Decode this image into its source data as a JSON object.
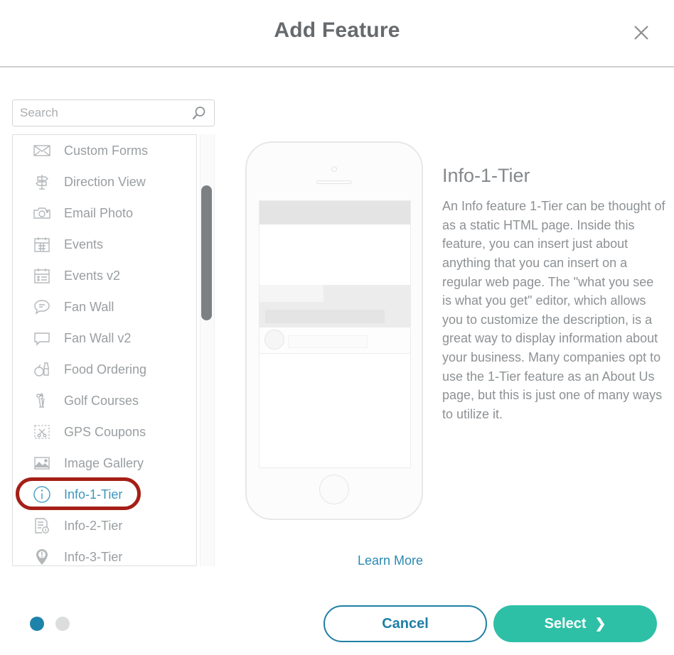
{
  "header": {
    "title": "Add Feature",
    "close_icon": "close-icon"
  },
  "search": {
    "placeholder": "Search",
    "value": "",
    "icon": "search-icon"
  },
  "feature_list": {
    "selected": "Info-1-Tier",
    "items": [
      {
        "label": "Custom Forms",
        "icon": "envelope-icon",
        "selected": false
      },
      {
        "label": "Direction View",
        "icon": "signpost-icon",
        "selected": false
      },
      {
        "label": "Email Photo",
        "icon": "camera-icon",
        "selected": false
      },
      {
        "label": "Events",
        "icon": "calendar-grid-icon",
        "selected": false
      },
      {
        "label": "Events v2",
        "icon": "calendar-list-icon",
        "selected": false
      },
      {
        "label": "Fan Wall",
        "icon": "speech-bubble-icon",
        "selected": false
      },
      {
        "label": "Fan Wall v2",
        "icon": "chat-box-icon",
        "selected": false
      },
      {
        "label": "Food Ordering",
        "icon": "food-bottle-icon",
        "selected": false
      },
      {
        "label": "Golf Courses",
        "icon": "golf-clubs-icon",
        "selected": false
      },
      {
        "label": "GPS Coupons",
        "icon": "coupon-scissors-icon",
        "selected": false
      },
      {
        "label": "Image Gallery",
        "icon": "image-icon",
        "selected": false
      },
      {
        "label": "Info-1-Tier",
        "icon": "info-circle-icon",
        "selected": true
      },
      {
        "label": "Info-2-Tier",
        "icon": "document-info-icon",
        "selected": false
      },
      {
        "label": "Info-3-Tier",
        "icon": "map-pin-info-icon",
        "selected": false
      }
    ]
  },
  "annotation": {
    "shape": "ellipse",
    "color": "#a51f17",
    "targets": "Info-1-Tier"
  },
  "preview": {
    "device": "phone-mockup",
    "screen_placeholder": "wireframe"
  },
  "detail": {
    "title": "Info-1-Tier",
    "description": "An Info feature 1-Tier can be thought of as a static HTML page. Inside this feature, you can insert just about anything that you can insert on a regular web page. The \"what you see is what you get\" editor, which allows you to customize the description, is a great way to display information about your business. Many companies opt to use the 1-Tier feature as an About Us page, but this is just one of many ways to utilize it.",
    "learn_more_label": "Learn More"
  },
  "footer": {
    "pager": {
      "total": 2,
      "active_index": 0
    },
    "cancel_label": "Cancel",
    "select_label": "Select",
    "select_chevron": "chevron-right-icon"
  },
  "colors": {
    "accent_teal": "#2ec0a6",
    "accent_blue": "#1f7fa4",
    "link_blue": "#2a89b3",
    "selected_text": "#3d96bd",
    "annotation_red": "#a51f17",
    "text_gray": "#8d9194",
    "title_gray": "#666a6d"
  }
}
